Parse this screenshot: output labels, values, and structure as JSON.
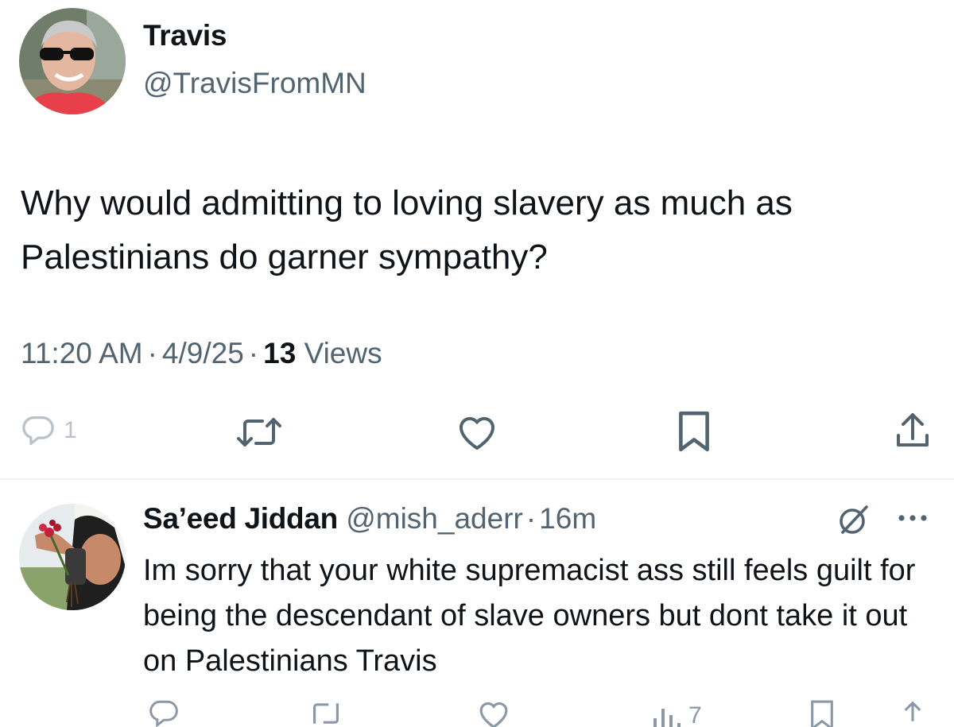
{
  "main_tweet": {
    "author_name": "Travis",
    "author_handle": "@TravisFromMN",
    "text": "Why would admitting to loving slavery as much as Palestinians do garner sympathy?",
    "time": "11:20 AM",
    "date": "4/9/25",
    "views_count": "13",
    "views_label": "Views",
    "separator": "·",
    "reply_count": "1"
  },
  "reply": {
    "author_name": "Sa’eed Jiddan",
    "author_handle": "@mish_aderr",
    "separator": "·",
    "time": "16m",
    "text": "Im sorry that your white supremacist ass still feels guilt for being the descendant of slave owners but dont take it out on Palestinians Travis",
    "views_count": "7"
  },
  "icons": {
    "reply": "reply-icon",
    "retweet": "retweet-icon",
    "like": "heart-icon",
    "bookmark": "bookmark-icon",
    "share": "share-icon",
    "grok": "grok-icon",
    "more": "more-icon",
    "views": "views-icon"
  },
  "colors": {
    "text_primary": "#0f1419",
    "text_secondary": "#536471",
    "icon_gray": "#536471",
    "divider": "#eff3f4"
  }
}
